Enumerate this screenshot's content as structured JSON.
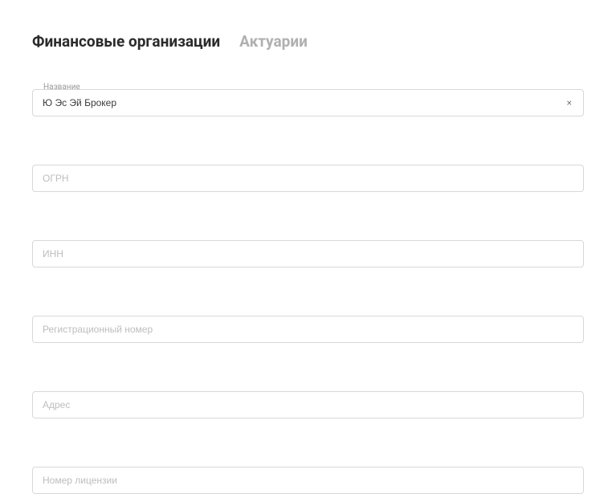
{
  "tabs": {
    "financial_orgs": "Финансовые организации",
    "actuaries": "Актуарии"
  },
  "fields": {
    "name": {
      "label": "Название",
      "value": "Ю Эс Эй Брокер"
    },
    "ogrn": {
      "placeholder": "ОГРН",
      "value": ""
    },
    "inn": {
      "placeholder": "ИНН",
      "value": ""
    },
    "reg_number": {
      "placeholder": "Регистрационный номер",
      "value": ""
    },
    "address": {
      "placeholder": "Адрес",
      "value": ""
    },
    "license_number": {
      "placeholder": "Номер лицензии",
      "value": ""
    }
  },
  "icons": {
    "clear": "×"
  }
}
